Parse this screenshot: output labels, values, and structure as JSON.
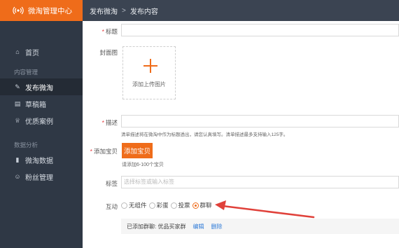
{
  "brand": {
    "title": "微淘管理中心"
  },
  "breadcrumb": {
    "root": "发布微淘",
    "separator": ">",
    "current": "发布内容"
  },
  "sidebar": {
    "home": "首页",
    "group_content": "内容管理",
    "items_content": [
      {
        "label": "发布微淘",
        "icon": "edit-icon"
      },
      {
        "label": "草稿箱",
        "icon": "draft-icon"
      },
      {
        "label": "优质案例",
        "icon": "case-icon"
      }
    ],
    "group_data": "数据分析",
    "items_data": [
      {
        "label": "微淘数据",
        "icon": "bar-chart-icon"
      },
      {
        "label": "粉丝管理",
        "icon": "fans-icon"
      }
    ]
  },
  "form": {
    "title_label": "标题",
    "cover_label": "封面图",
    "upload_text": "添加上传图片",
    "desc_label": "描述",
    "desc_hint": "清单描述将在微淘中作为标题透出，请您认真填写。清单描述最多支持输入125字。",
    "item_label": "添加宝贝",
    "add_item_button": "添加宝贝",
    "item_hint": "请添加6-100个宝贝",
    "tag_label": "标签",
    "tag_placeholder": "选择标签或输入标签",
    "interact_label": "互动",
    "interact_options": [
      "无组件",
      "彩蛋",
      "投票",
      "群聊"
    ],
    "interact_selected": "群聊",
    "group_added": "已添加群聊: 优品买家群",
    "edit_link": "编辑",
    "delete_link": "删除",
    "required_mark": "*"
  },
  "colors": {
    "accent": "#ef6c1a",
    "sidebar_bg": "#2f3845",
    "link": "#2f7bd8",
    "arrow": "#e0413a"
  }
}
